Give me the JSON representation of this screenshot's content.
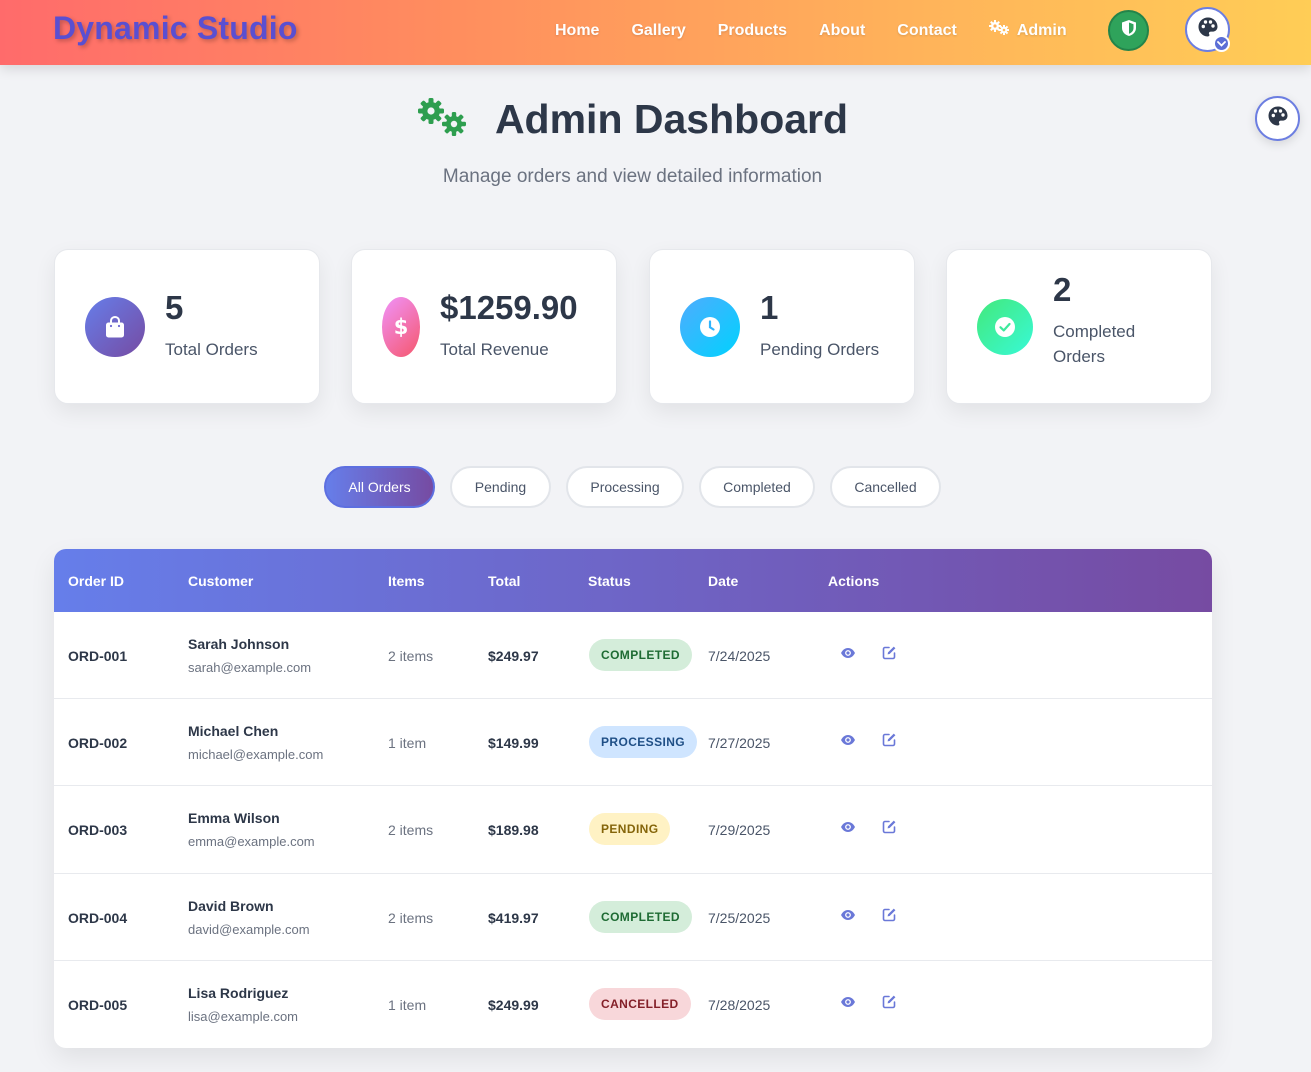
{
  "brand": "Dynamic Studio",
  "nav": {
    "home": "Home",
    "gallery": "Gallery",
    "products": "Products",
    "about": "About",
    "contact": "Contact",
    "admin": "Admin"
  },
  "header": {
    "title": "Admin Dashboard",
    "subtitle": "Manage orders and view detailed information"
  },
  "stats": [
    {
      "value": "5",
      "label": "Total Orders",
      "icon": "shopping-bag-icon",
      "color": "#667eea"
    },
    {
      "value": "$1259.90",
      "label": "Total Revenue",
      "icon": "dollar-icon",
      "color": "#f5576c"
    },
    {
      "value": "1",
      "label": "Pending Orders",
      "icon": "clock-icon",
      "color": "#00c6fb"
    },
    {
      "value": "2",
      "label": "Completed Orders",
      "icon": "check-circle-icon",
      "color": "#43e97b"
    }
  ],
  "filters": [
    "All Orders",
    "Pending",
    "Processing",
    "Completed",
    "Cancelled"
  ],
  "active_filter": "All Orders",
  "table": {
    "headers": [
      "Order ID",
      "Customer",
      "Items",
      "Total",
      "Status",
      "Date",
      "Actions"
    ],
    "rows": [
      {
        "id": "ORD-001",
        "name": "Sarah Johnson",
        "email": "sarah@example.com",
        "items": "2 items",
        "total": "$249.97",
        "status": "COMPLETED",
        "date": "7/24/2025"
      },
      {
        "id": "ORD-002",
        "name": "Michael Chen",
        "email": "michael@example.com",
        "items": "1 item",
        "total": "$149.99",
        "status": "PROCESSING",
        "date": "7/27/2025"
      },
      {
        "id": "ORD-003",
        "name": "Emma Wilson",
        "email": "emma@example.com",
        "items": "2 items",
        "total": "$189.98",
        "status": "PENDING",
        "date": "7/29/2025"
      },
      {
        "id": "ORD-004",
        "name": "David Brown",
        "email": "david@example.com",
        "items": "2 items",
        "total": "$419.97",
        "status": "COMPLETED",
        "date": "7/25/2025"
      },
      {
        "id": "ORD-005",
        "name": "Lisa Rodriguez",
        "email": "lisa@example.com",
        "items": "1 item",
        "total": "$249.99",
        "status": "CANCELLED",
        "date": "7/28/2025"
      }
    ]
  },
  "status_colors": {
    "COMPLETED": {
      "bg": "#d4edda",
      "fg": "#1e6b33"
    },
    "PROCESSING": {
      "bg": "#cfe5ff",
      "fg": "#1f4f86"
    },
    "PENDING": {
      "bg": "#fff2c4",
      "fg": "#85650a"
    },
    "CANCELLED": {
      "bg": "#f8d7da",
      "fg": "#842029"
    }
  },
  "colors": {
    "accent_start": "#667eea",
    "accent_end": "#764ba2",
    "admin_green": "#2fa35b"
  }
}
